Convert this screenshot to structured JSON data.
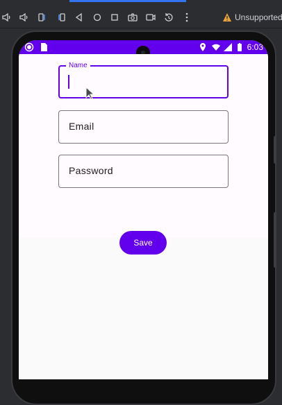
{
  "toolbar": {
    "icons": [
      "volume-down-icon",
      "volume-up-icon",
      "rotate-left-icon",
      "rotate-right-icon",
      "back-icon",
      "home-icon",
      "overview-icon",
      "screenshot-icon",
      "screen-record-icon",
      "reset-icon",
      "more-icon"
    ],
    "warning_label": "Unsupported"
  },
  "status_bar": {
    "time": "6:03",
    "color": "#6200ee"
  },
  "form": {
    "name_label": "Name",
    "name_value": "",
    "email_label": "Email",
    "password_label": "Password",
    "save_label": "Save"
  },
  "colors": {
    "accent": "#6200ee",
    "outline": "#79747e",
    "surface": "#fffbfe"
  }
}
